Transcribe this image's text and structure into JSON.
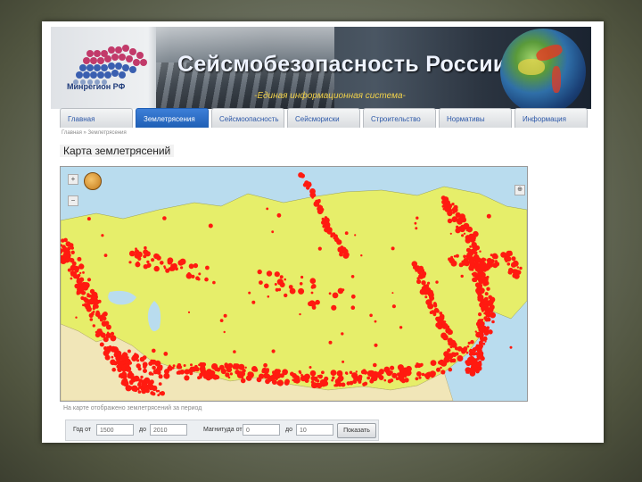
{
  "header": {
    "logo_text": "Минрегион РФ",
    "title": "Сейсмобезопасность России",
    "subtitle": "-Единая информационная система-"
  },
  "nav": {
    "tabs": [
      "Главная",
      "Землетрясения",
      "Сейсмоопасность",
      "Сейсмориски",
      "Строительство",
      "Нормативы",
      "Информация"
    ],
    "active_index": 1
  },
  "breadcrumb": "Главная » Землетрясения",
  "page_title": "Карта землетрясений",
  "map": {
    "controls": [
      "+",
      "−"
    ],
    "land_color": "#e6ee6a",
    "quake_color": "#ff0000",
    "water_color": "#b9dcee"
  },
  "caption": "На карте отображено землетрясений за период",
  "filter": {
    "year_from_label": "Год от",
    "year_from_value": "1500",
    "year_to_label": "до",
    "year_to_value": "2010",
    "mag_from_label": "Магнитуда от",
    "mag_from_value": "0",
    "mag_to_label": "до",
    "mag_to_value": "10",
    "submit_label": "Показать"
  }
}
